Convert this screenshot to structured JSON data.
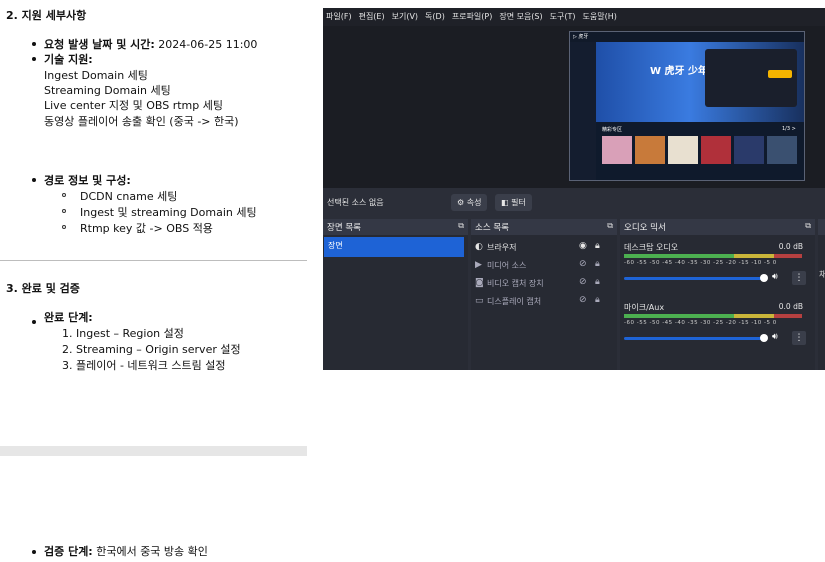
{
  "doc": {
    "section2_title": "2. 지원 세부사항",
    "item_request_label": "요청 발생 날짜 및 시간:",
    "item_request_value": " 2024-06-25 11:00",
    "item_tech_label": "기술 지원:",
    "tech_lines": [
      "Ingest Domain 세팅",
      "Streaming Domain 세팅",
      "Live center 지정 및 OBS rtmp 세팅",
      "동영상 플레이어 송출 확인 (중국 -> 한국)"
    ],
    "item_path_label": "경로 정보 및 구성:",
    "path_lines": [
      "DCDN cname 세팅",
      "Ingest 및 streaming Domain 세팅",
      "Rtmp key 값 -> OBS 적용"
    ],
    "section3_title": "3. 완료 및 검증",
    "item_complete_label": "완료 단계:",
    "complete_lines": [
      "1. Ingest – Region 설정",
      "2. Streaming – Origin server 설정",
      "3. 플레이어 - 네트워크 스트림 설정"
    ],
    "item_verify_label": "검증 단계:",
    "item_verify_value": " 한국에서 중국 방송 확인"
  },
  "obs": {
    "menu": [
      "파일(F)",
      "편집(E)",
      "보기(V)",
      "독(D)",
      "프로파일(P)",
      "장면 모음(S)",
      "도구(T)",
      "도움말(H)"
    ],
    "no_source": "선택된 소스 없음",
    "props_btn": "속성",
    "filter_btn": "필터",
    "scenes_title": "장면 목록",
    "scene_item": "장면",
    "sources_title": "소스 목록",
    "sources": [
      {
        "icon": "globe-icon",
        "glyph": "◐",
        "name": "브라우저",
        "visible": true
      },
      {
        "icon": "play-icon",
        "glyph": "▶",
        "name": "미디어 소스",
        "visible": false
      },
      {
        "icon": "camera-icon",
        "glyph": "◙",
        "name": "비디오 캡처 장치",
        "visible": false
      },
      {
        "icon": "monitor-icon",
        "glyph": "▭",
        "name": "디스플레이 캡처",
        "visible": false
      }
    ],
    "mixer_title": "오디오 믹서",
    "mixer": [
      {
        "name": "데스크탑 오디오",
        "db": "0.0 dB"
      },
      {
        "name": "마이크/Aux",
        "db": "0.0 dB"
      }
    ],
    "meter_ticks": "-60 -55 -50 -45 -40 -35 -30 -25 -20 -15 -10 -5 0",
    "right_cut": "채",
    "preview": {
      "logo": "▷ 虎牙",
      "banner": "W 虎牙 少年",
      "section": "精彩专区",
      "page": "1/3 >"
    }
  }
}
